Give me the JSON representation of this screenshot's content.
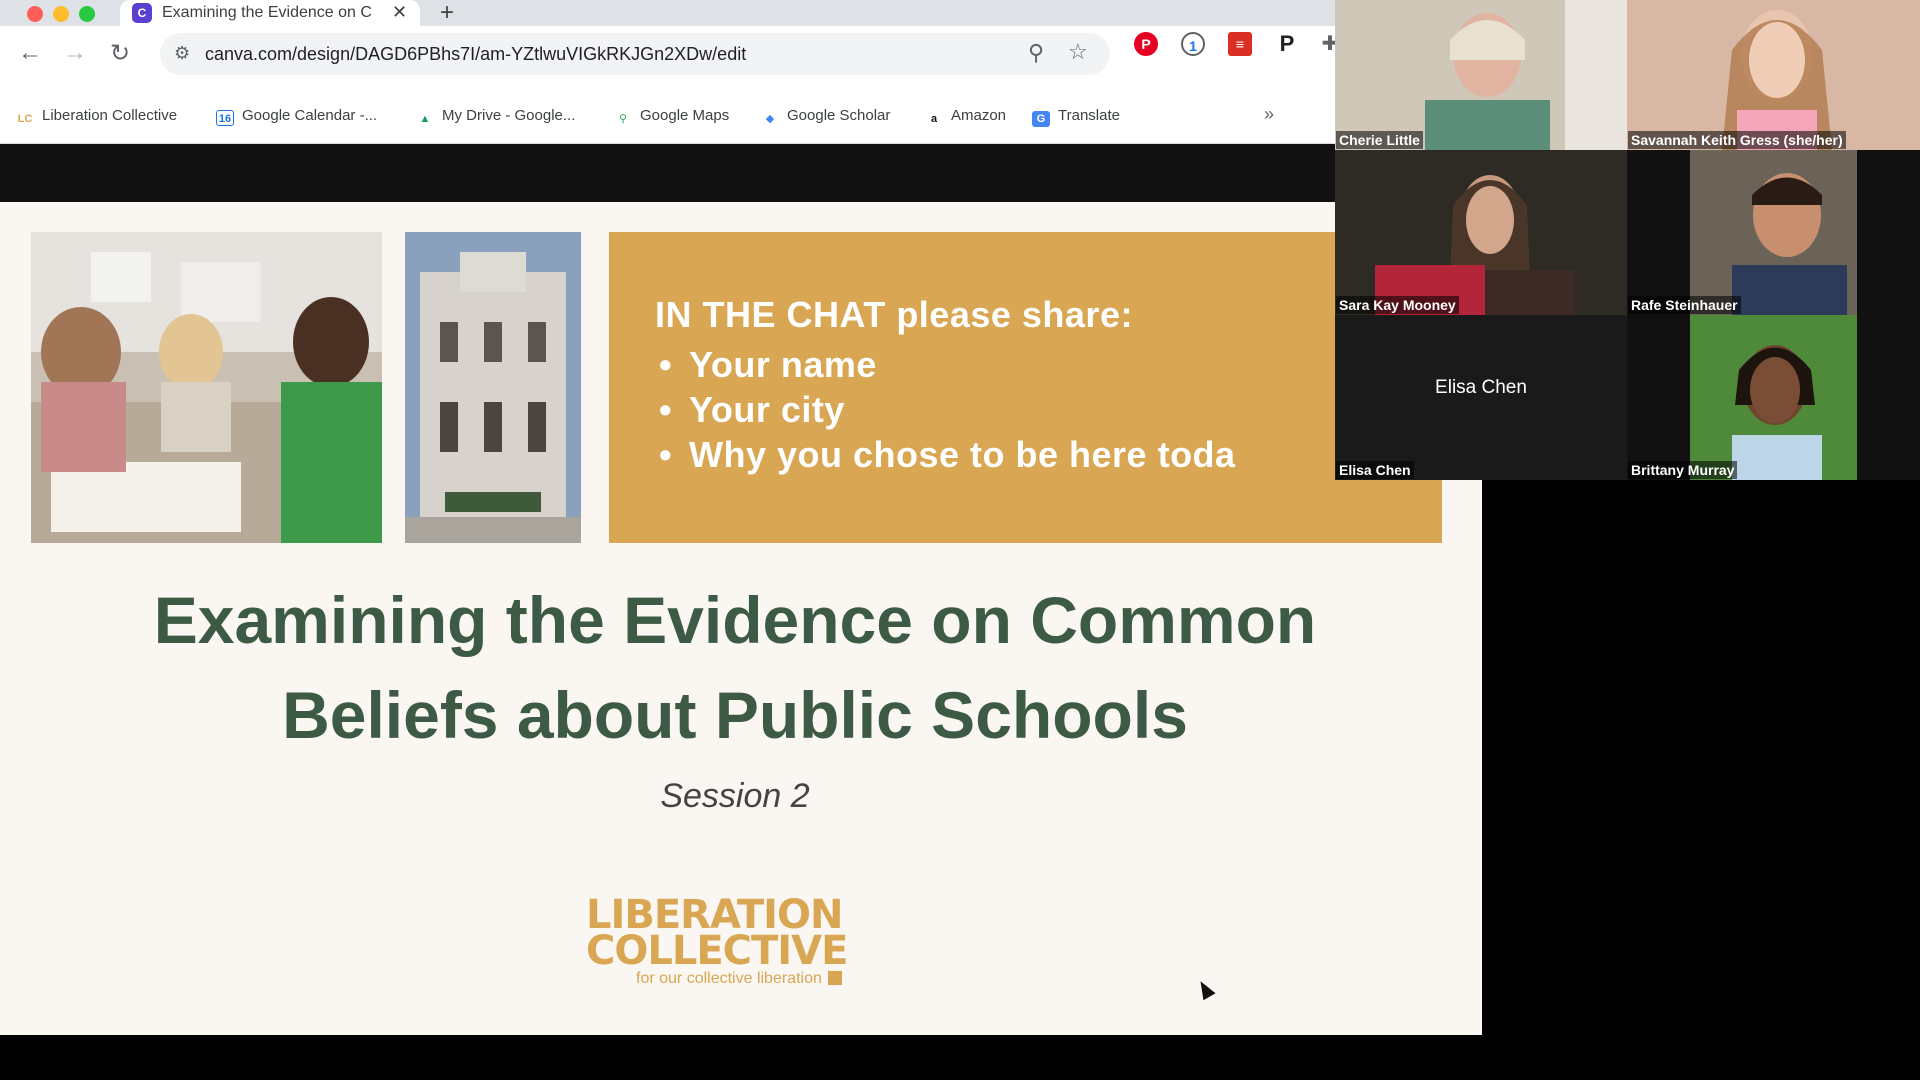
{
  "browser": {
    "tab_title": "Examining the Evidence on C",
    "tab_close": "✕",
    "new_tab": "+",
    "url": "canva.com/design/DAGD6PBhs7I/am-YZtlwuVIGkRKJGn2XDw/edit",
    "bookmarks": [
      {
        "label": "Liberation Collective",
        "icon": "LC",
        "color": "#d9a653"
      },
      {
        "label": "Google Calendar -...",
        "icon": "16",
        "color": "#1a73e8"
      },
      {
        "label": "My Drive - Google...",
        "icon": "▲",
        "color": "#0f9d58"
      },
      {
        "label": "Google Maps",
        "icon": "⚲",
        "color": "#34a853"
      },
      {
        "label": "Google Scholar",
        "icon": "◆",
        "color": "#4285f4"
      },
      {
        "label": "Amazon",
        "icon": "a",
        "color": "#111111"
      },
      {
        "label": "Translate",
        "icon": "G",
        "color": "#4285f4"
      }
    ],
    "more_bookmarks": "»",
    "extension_p": "P"
  },
  "slide": {
    "chat_heading": "IN THE CHAT please share:",
    "chat_items": [
      "Your name",
      "Your city",
      "Why you chose to be here toda"
    ],
    "title_line1": "Examining the Evidence on Common",
    "title_line2": "Beliefs about Public Schools",
    "session": "Session 2",
    "logo_line1": "LIBERATION",
    "logo_line2": "COLLECTIVE",
    "logo_tagline": "for our collective liberation"
  },
  "participants": [
    {
      "name": "Cherie Little"
    },
    {
      "name": "Savannah Keith Gress (she/her)"
    },
    {
      "name": "Sara Kay Mooney"
    },
    {
      "name": "Rafe Steinhauer"
    },
    {
      "name": "Elisa Chen",
      "center_name": "Elisa Chen"
    },
    {
      "name": "Brittany Murray"
    }
  ],
  "colors": {
    "accent_gold": "#d9a653",
    "title_green": "#3d5a44",
    "slide_bg": "#faf7f2"
  }
}
